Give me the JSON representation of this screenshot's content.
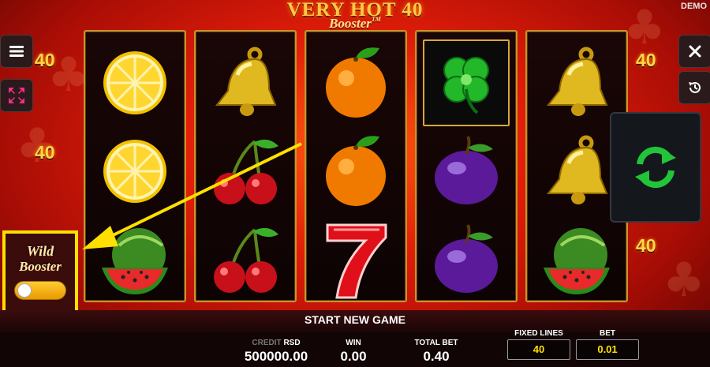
{
  "header": {
    "title_main": "VERY HOT 40",
    "title_sub": "Booster",
    "trademark": "TM",
    "mode_badge": "DEMO"
  },
  "lines_labels": {
    "left_top": "40",
    "left_mid": "40",
    "right_top": "40",
    "right_bottom": "40"
  },
  "reels": [
    [
      "lemon",
      "lemon",
      "watermelon"
    ],
    [
      "bell",
      "cherry",
      "cherry"
    ],
    [
      "orange",
      "orange",
      "seven"
    ],
    [
      "clover",
      "plum",
      "plum"
    ],
    [
      "bell",
      "bell",
      "watermelon"
    ]
  ],
  "side_buttons": {
    "menu_icon": "menu-icon",
    "fullscreen_icon": "fullscreen-icon",
    "close_icon": "close-icon",
    "history_icon": "history-icon",
    "spin_icon": "spin-refresh-icon"
  },
  "wild_booster": {
    "label_line1": "Wild",
    "label_line2": "Booster",
    "enabled": false
  },
  "bottom": {
    "start_label": "START NEW GAME",
    "credit_label_dim": "CREDIT",
    "credit_currency": "RSD",
    "credit_value": "500000.00",
    "win_label": "WIN",
    "win_value": "0.00",
    "total_bet_label": "TOTAL BET",
    "total_bet_value": "0.40",
    "fixed_lines_label": "FIXED LINES",
    "fixed_lines_value": "40",
    "bet_label": "BET",
    "bet_value": "0.01"
  },
  "colors": {
    "accent_yellow": "#ffe000",
    "spin_green": "#22c43a",
    "reel_border_gold": "#c8942a"
  }
}
